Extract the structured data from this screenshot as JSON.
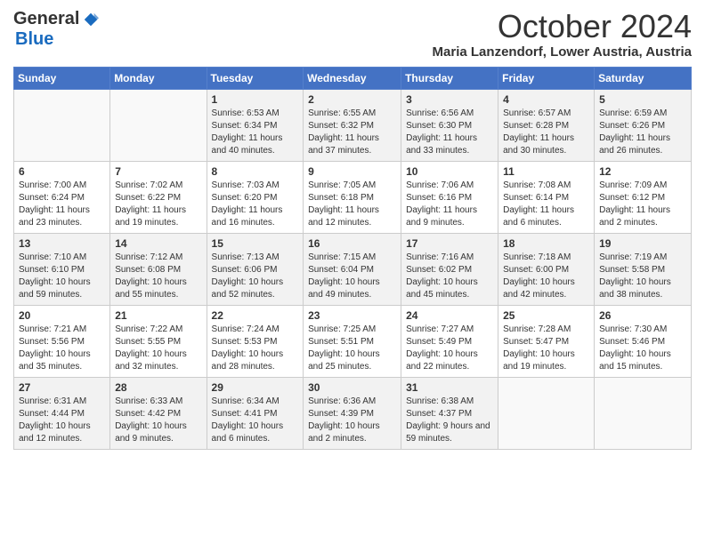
{
  "header": {
    "logo_general": "General",
    "logo_blue": "Blue",
    "title": "October 2024",
    "location": "Maria Lanzendorf, Lower Austria, Austria"
  },
  "days_of_week": [
    "Sunday",
    "Monday",
    "Tuesday",
    "Wednesday",
    "Thursday",
    "Friday",
    "Saturday"
  ],
  "weeks": [
    [
      {
        "day": "",
        "info": ""
      },
      {
        "day": "",
        "info": ""
      },
      {
        "day": "1",
        "info": "Sunrise: 6:53 AM\nSunset: 6:34 PM\nDaylight: 11 hours and 40 minutes."
      },
      {
        "day": "2",
        "info": "Sunrise: 6:55 AM\nSunset: 6:32 PM\nDaylight: 11 hours and 37 minutes."
      },
      {
        "day": "3",
        "info": "Sunrise: 6:56 AM\nSunset: 6:30 PM\nDaylight: 11 hours and 33 minutes."
      },
      {
        "day": "4",
        "info": "Sunrise: 6:57 AM\nSunset: 6:28 PM\nDaylight: 11 hours and 30 minutes."
      },
      {
        "day": "5",
        "info": "Sunrise: 6:59 AM\nSunset: 6:26 PM\nDaylight: 11 hours and 26 minutes."
      }
    ],
    [
      {
        "day": "6",
        "info": "Sunrise: 7:00 AM\nSunset: 6:24 PM\nDaylight: 11 hours and 23 minutes."
      },
      {
        "day": "7",
        "info": "Sunrise: 7:02 AM\nSunset: 6:22 PM\nDaylight: 11 hours and 19 minutes."
      },
      {
        "day": "8",
        "info": "Sunrise: 7:03 AM\nSunset: 6:20 PM\nDaylight: 11 hours and 16 minutes."
      },
      {
        "day": "9",
        "info": "Sunrise: 7:05 AM\nSunset: 6:18 PM\nDaylight: 11 hours and 12 minutes."
      },
      {
        "day": "10",
        "info": "Sunrise: 7:06 AM\nSunset: 6:16 PM\nDaylight: 11 hours and 9 minutes."
      },
      {
        "day": "11",
        "info": "Sunrise: 7:08 AM\nSunset: 6:14 PM\nDaylight: 11 hours and 6 minutes."
      },
      {
        "day": "12",
        "info": "Sunrise: 7:09 AM\nSunset: 6:12 PM\nDaylight: 11 hours and 2 minutes."
      }
    ],
    [
      {
        "day": "13",
        "info": "Sunrise: 7:10 AM\nSunset: 6:10 PM\nDaylight: 10 hours and 59 minutes."
      },
      {
        "day": "14",
        "info": "Sunrise: 7:12 AM\nSunset: 6:08 PM\nDaylight: 10 hours and 55 minutes."
      },
      {
        "day": "15",
        "info": "Sunrise: 7:13 AM\nSunset: 6:06 PM\nDaylight: 10 hours and 52 minutes."
      },
      {
        "day": "16",
        "info": "Sunrise: 7:15 AM\nSunset: 6:04 PM\nDaylight: 10 hours and 49 minutes."
      },
      {
        "day": "17",
        "info": "Sunrise: 7:16 AM\nSunset: 6:02 PM\nDaylight: 10 hours and 45 minutes."
      },
      {
        "day": "18",
        "info": "Sunrise: 7:18 AM\nSunset: 6:00 PM\nDaylight: 10 hours and 42 minutes."
      },
      {
        "day": "19",
        "info": "Sunrise: 7:19 AM\nSunset: 5:58 PM\nDaylight: 10 hours and 38 minutes."
      }
    ],
    [
      {
        "day": "20",
        "info": "Sunrise: 7:21 AM\nSunset: 5:56 PM\nDaylight: 10 hours and 35 minutes."
      },
      {
        "day": "21",
        "info": "Sunrise: 7:22 AM\nSunset: 5:55 PM\nDaylight: 10 hours and 32 minutes."
      },
      {
        "day": "22",
        "info": "Sunrise: 7:24 AM\nSunset: 5:53 PM\nDaylight: 10 hours and 28 minutes."
      },
      {
        "day": "23",
        "info": "Sunrise: 7:25 AM\nSunset: 5:51 PM\nDaylight: 10 hours and 25 minutes."
      },
      {
        "day": "24",
        "info": "Sunrise: 7:27 AM\nSunset: 5:49 PM\nDaylight: 10 hours and 22 minutes."
      },
      {
        "day": "25",
        "info": "Sunrise: 7:28 AM\nSunset: 5:47 PM\nDaylight: 10 hours and 19 minutes."
      },
      {
        "day": "26",
        "info": "Sunrise: 7:30 AM\nSunset: 5:46 PM\nDaylight: 10 hours and 15 minutes."
      }
    ],
    [
      {
        "day": "27",
        "info": "Sunrise: 6:31 AM\nSunset: 4:44 PM\nDaylight: 10 hours and 12 minutes."
      },
      {
        "day": "28",
        "info": "Sunrise: 6:33 AM\nSunset: 4:42 PM\nDaylight: 10 hours and 9 minutes."
      },
      {
        "day": "29",
        "info": "Sunrise: 6:34 AM\nSunset: 4:41 PM\nDaylight: 10 hours and 6 minutes."
      },
      {
        "day": "30",
        "info": "Sunrise: 6:36 AM\nSunset: 4:39 PM\nDaylight: 10 hours and 2 minutes."
      },
      {
        "day": "31",
        "info": "Sunrise: 6:38 AM\nSunset: 4:37 PM\nDaylight: 9 hours and 59 minutes."
      },
      {
        "day": "",
        "info": ""
      },
      {
        "day": "",
        "info": ""
      }
    ]
  ]
}
